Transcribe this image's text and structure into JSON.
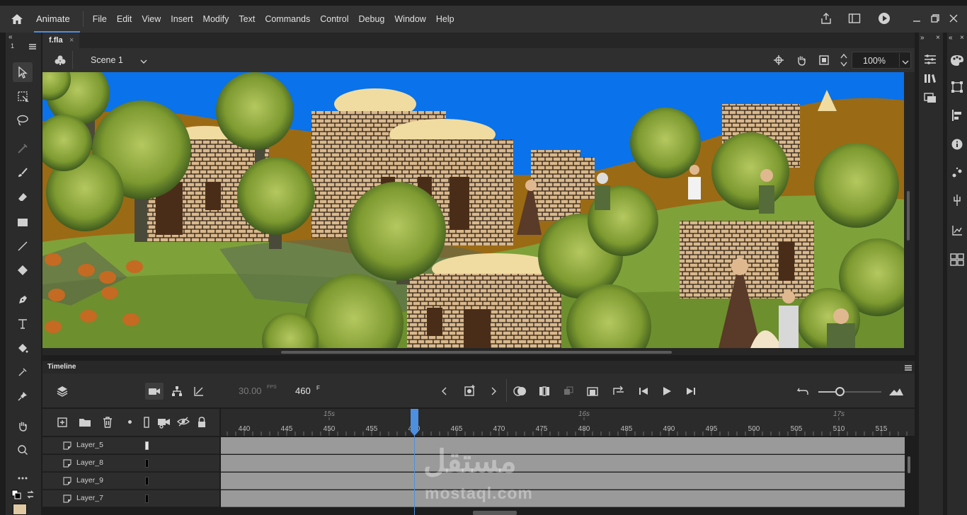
{
  "app": {
    "name": "Animate"
  },
  "menu": [
    "File",
    "Edit",
    "View",
    "Insert",
    "Modify",
    "Text",
    "Commands",
    "Control",
    "Debug",
    "Window",
    "Help"
  ],
  "toolbar_top": {
    "arrows": "«",
    "number": "1"
  },
  "document": {
    "tab_name": "f.fla",
    "close": "×"
  },
  "scene": {
    "name": "Scene 1",
    "zoom": "100%"
  },
  "timeline": {
    "title": "Timeline",
    "fps_value": "30.00",
    "fps_unit": "FPS",
    "frame_value": "460",
    "frame_unit": "F",
    "seconds": [
      "15s",
      "16s",
      "17s"
    ],
    "frame_ticks": [
      "440",
      "445",
      "450",
      "455",
      "460",
      "465",
      "470",
      "475",
      "480",
      "485",
      "490",
      "495",
      "500",
      "505",
      "510",
      "515"
    ],
    "playhead_frame": 460,
    "layers": [
      "Layer_5",
      "Layer_8",
      "Layer_9",
      "Layer_7"
    ]
  },
  "watermark": {
    "arabic": "مستقل",
    "latin": "mostaql.com"
  },
  "colors": {
    "sky": "#0a72ea",
    "accent": "#4d8fe0",
    "grass": "#7fa13a",
    "stone": "#d7b48a"
  }
}
